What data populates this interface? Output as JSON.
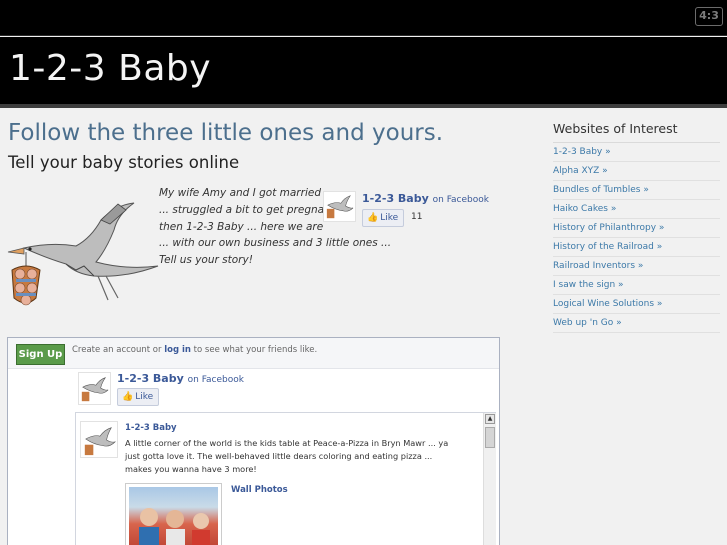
{
  "topbar": {
    "aspect_badge": "4:3"
  },
  "header": {
    "site_title": "1-2-3 Baby"
  },
  "main": {
    "headline": "Follow the three little ones and yours.",
    "subheadline": "Tell your baby stories online",
    "story_lines": [
      "My wife Amy and I got married",
      "... struggled a bit to get pregnant",
      "then 1-2-3 Baby ... here we are",
      "... with our own business and 3 little ones ...",
      "Tell us your story!"
    ]
  },
  "facebook_mini": {
    "page_name": "1-2-3 Baby",
    "on_facebook": "on Facebook",
    "like_label": "Like",
    "like_count": "11"
  },
  "sidebar": {
    "title": "Websites of Interest",
    "links": [
      "1-2-3 Baby »",
      "Alpha XYZ »",
      "Bundles of Tumbles »",
      "Haiko Cakes »",
      "History of Philanthropy »",
      "History of the Railroad »",
      "Railroad Inventors »",
      "I saw the sign »",
      "Logical Wine Solutions »",
      "Web up 'n Go »"
    ]
  },
  "facebook_box": {
    "signup_label": "Sign Up",
    "prompt_before": "Create an account or ",
    "prompt_login": "log in",
    "prompt_after": " to see what your friends like.",
    "page_name": "1-2-3 Baby",
    "on_facebook": "on Facebook",
    "like_label": "Like",
    "post": {
      "author": "1-2-3 Baby",
      "text": "A little corner of the world is the kids table at Peace-a-Pizza in Bryn Mawr ... ya just gotta love it. The well-behaved little dears coloring and eating pizza ... makes you wanna have 3 more!",
      "wall_photos": "Wall Photos"
    }
  }
}
